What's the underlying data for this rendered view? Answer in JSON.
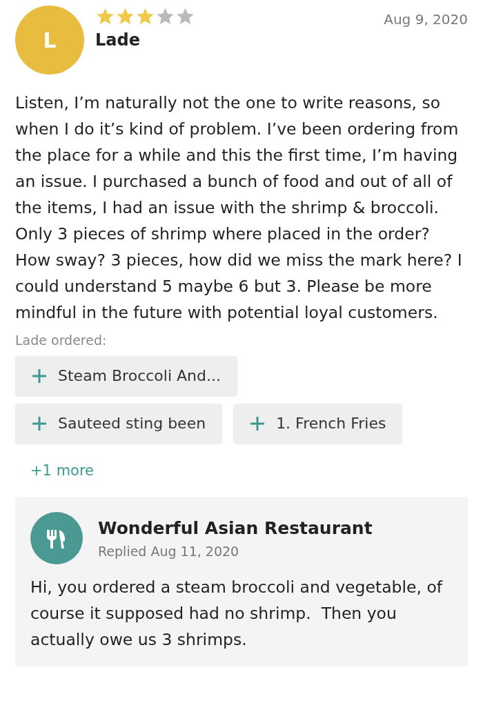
{
  "review": {
    "avatar_letter": "L",
    "stars": 3,
    "author": "Lade",
    "date": "Aug 9, 2020",
    "text": "Listen, I’m naturally not the one to write reasons, so when I do it’s kind of problem. I’ve been ordering from the place for a while and this the first time, I’m having an issue. I purchased a bunch of food and out of all of the items, I had an issue with the shrimp & broccoli. Only 3 pieces of shrimp where placed in the order? How sway? 3 pieces, how did we miss the mark here? I could understand 5 maybe 6 but 3. Please be more mindful in the future with potential loyal customers.",
    "ordered_label": "Lade ordered:",
    "ordered_items": [
      {
        "label": "Steam Broccoli And..."
      },
      {
        "label": "Sauteed sting been"
      },
      {
        "label": "1. French Fries"
      }
    ],
    "more_link": "+1 more"
  },
  "reply": {
    "name": "Wonderful Asian Restaurant",
    "date": "Replied Aug 11, 2020",
    "text": "Hi, you ordered a steam broccoli and vegetable, of course it supposed had no shrimp.  Then you actually owe us 3 shrimps."
  }
}
